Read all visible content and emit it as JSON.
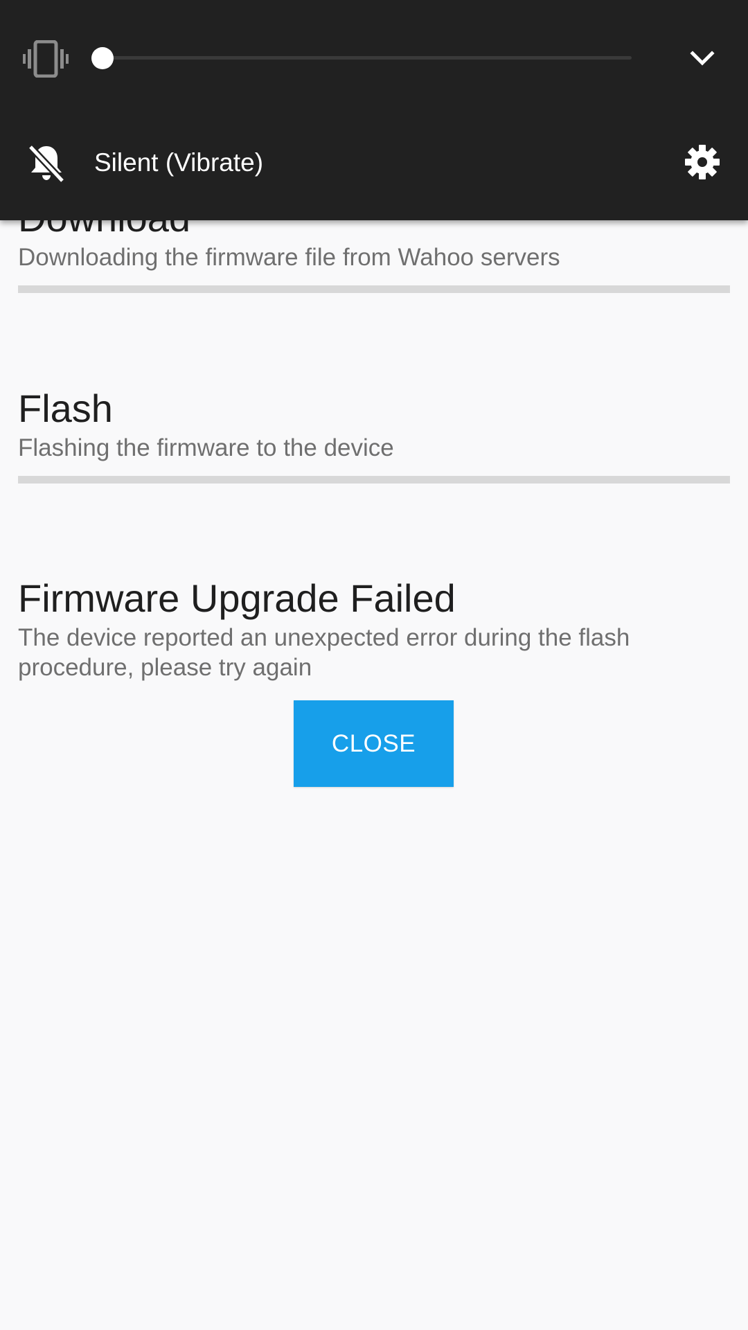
{
  "volume_panel": {
    "ringer_mode": "Silent (Vibrate)",
    "volume_level": 0,
    "icons": {
      "mode": "vibrate-icon",
      "expand": "chevron-down-icon",
      "ringer_state": "bell-off-icon",
      "settings": "gear-icon"
    },
    "background_color": "#212121"
  },
  "steps": {
    "download": {
      "title": "Download",
      "description": "Downloading the firmware file from Wahoo servers",
      "progress": 0
    },
    "flash": {
      "title": "Flash",
      "description": "Flashing the firmware to the device",
      "progress": 0
    },
    "result": {
      "title": "Firmware Upgrade Failed",
      "description": "The device reported an unexpected error during the flash procedure, please try again"
    }
  },
  "actions": {
    "close_label": "CLOSE"
  },
  "colors": {
    "accent": "#179fea",
    "progress_track": "#d8d8d8",
    "title_text": "#1f1f1f",
    "secondary_text": "#6f6f6f"
  }
}
